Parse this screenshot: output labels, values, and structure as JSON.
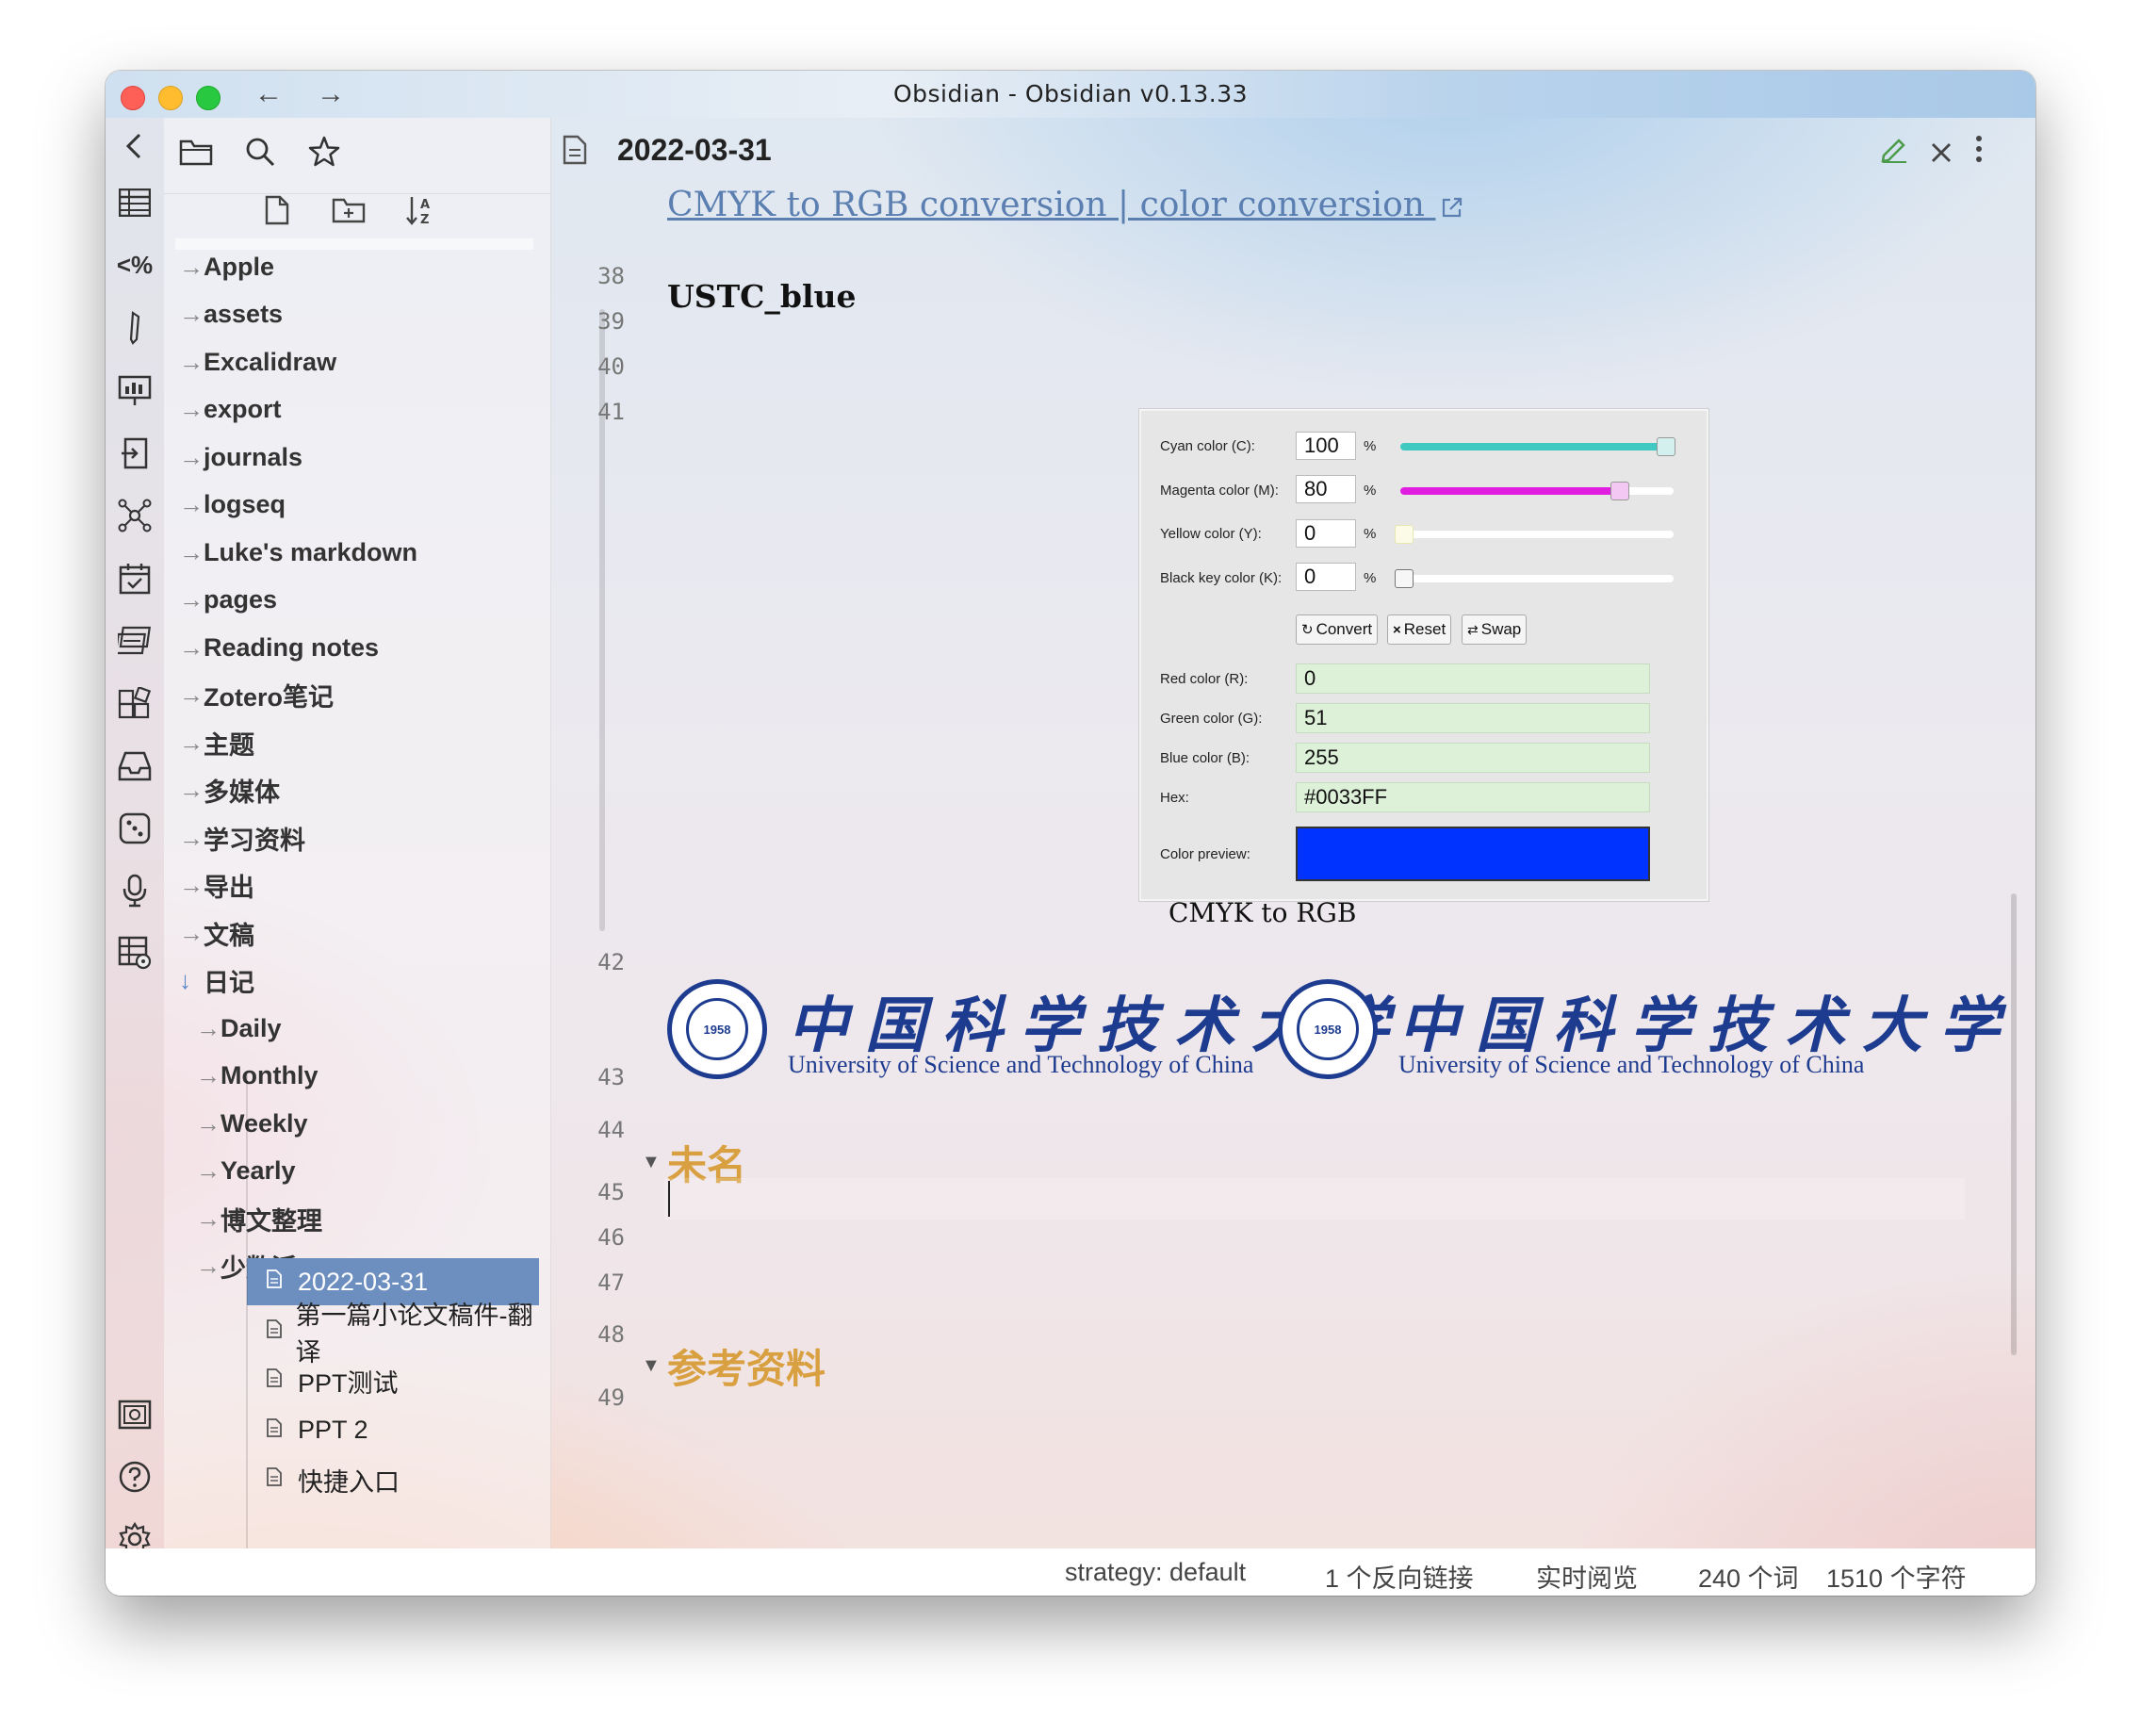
{
  "window": {
    "title": "Obsidian - Obsidian v0.13.33",
    "back_arrow": "←",
    "forward_arrow": "→"
  },
  "ribbon": {
    "collapse_icon": "chevron-left-icon",
    "icons": [
      "table-icon",
      "templater-icon",
      "pen-icon",
      "slides-icon",
      "import-icon",
      "graph-icon",
      "calendar-check-icon",
      "cards-icon",
      "apps-icon",
      "inbox-icon",
      "dice-icon",
      "microphone-icon",
      "table-settings-icon",
      "vault-icon",
      "help-icon",
      "settings-icon"
    ],
    "templater_label": "<%"
  },
  "explorer": {
    "top_icons": [
      "folder-icon",
      "search-icon",
      "star-icon"
    ],
    "actions": [
      "new-note-icon",
      "new-folder-icon",
      "sort-icon"
    ],
    "folders": [
      {
        "label": "Apple",
        "indent": 0
      },
      {
        "label": "assets",
        "indent": 0
      },
      {
        "label": "Excalidraw",
        "indent": 0
      },
      {
        "label": "export",
        "indent": 0
      },
      {
        "label": "journals",
        "indent": 0
      },
      {
        "label": "logseq",
        "indent": 0
      },
      {
        "label": "Luke's markdown",
        "indent": 0
      },
      {
        "label": "pages",
        "indent": 0
      },
      {
        "label": "Reading notes",
        "indent": 0
      },
      {
        "label": "Zotero笔记",
        "indent": 0
      },
      {
        "label": "主题",
        "indent": 0
      },
      {
        "label": "多媒体",
        "indent": 0
      },
      {
        "label": "学习资料",
        "indent": 0
      },
      {
        "label": "导出",
        "indent": 0
      },
      {
        "label": "文稿",
        "indent": 0
      },
      {
        "label": "日记",
        "indent": 0,
        "expanded": true
      },
      {
        "label": "Daily",
        "indent": 1
      },
      {
        "label": "Monthly",
        "indent": 1
      },
      {
        "label": "Weekly",
        "indent": 1
      },
      {
        "label": "Yearly",
        "indent": 1
      },
      {
        "label": "博文整理",
        "indent": 1
      },
      {
        "label": "少数派",
        "indent": 1
      }
    ],
    "files": [
      {
        "label": "2022-03-31",
        "active": true
      },
      {
        "label": "第一篇小论文稿件-翻译",
        "active": false
      },
      {
        "label": "PPT测试",
        "active": false
      },
      {
        "label": "PPT 2",
        "active": false
      },
      {
        "label": "快捷入口",
        "active": false
      }
    ],
    "collapsed_arrow": "→",
    "expanded_arrow": "↓"
  },
  "editor": {
    "title": "2022-03-31",
    "line_numbers": [
      "38",
      "39",
      "40",
      "41",
      "42",
      "43",
      "44",
      "45",
      "46",
      "47",
      "48",
      "49"
    ],
    "link_text": "CMYK to RGB conversion | color conversion",
    "label_ustc_blue": "USTC_blue",
    "image_caption": "CMYK to RGB",
    "heading_1": "未名",
    "heading_2": "参考资料",
    "logo": {
      "year": "1958",
      "cn_name": "中国科学技术大学",
      "en_name": "University of Science and Technology of China"
    }
  },
  "converter": {
    "cyan_label": "Cyan color (C):",
    "cyan_value": "100",
    "cyan_fraction": 1.0,
    "magenta_label": "Magenta color (M):",
    "magenta_value": "80",
    "magenta_fraction": 0.8,
    "yellow_label": "Yellow color (Y):",
    "yellow_value": "0",
    "yellow_fraction": 0,
    "black_label": "Black key color (K):",
    "black_value": "0",
    "black_fraction": 0,
    "percent": "%",
    "convert_label": "Convert",
    "reset_label": "Reset",
    "swap_label": "Swap",
    "red_label": "Red color (R):",
    "red_value": "0",
    "green_label": "Green color (G):",
    "green_value": "51",
    "blue_label": "Blue color (B):",
    "blue_value": "255",
    "hex_label": "Hex:",
    "hex_value": "#0033FF",
    "preview_label": "Color preview:",
    "preview_color": "#0033FF",
    "cyan_color": "#3fc9c1",
    "magenta_color": "#e01ee0"
  },
  "statusbar": {
    "strategy": "strategy: default",
    "backlinks": "1 个反向链接",
    "mode": "实时阅览",
    "words": "240 个词",
    "chars": "1510 个字符"
  }
}
